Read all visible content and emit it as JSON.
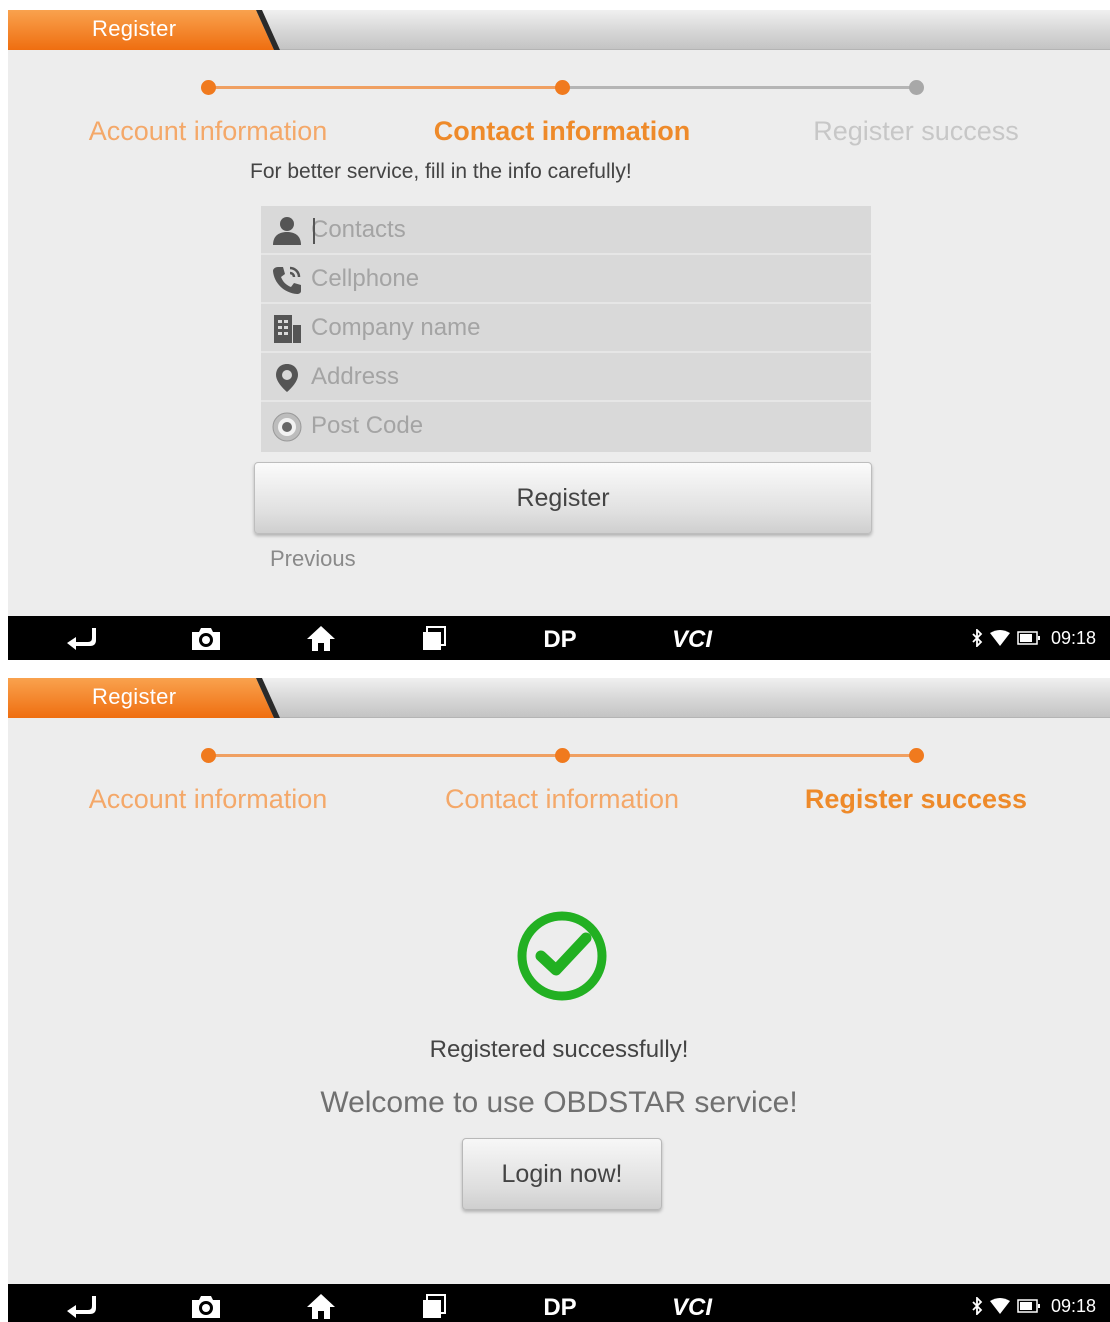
{
  "colors": {
    "accent": "#f07a1e",
    "step_active": "#ee8a2a",
    "step_inactive": "#b5b5b5",
    "success_green": "#22b022",
    "nav_bar": "#000000"
  },
  "screens": [
    {
      "title": "Register",
      "steps": [
        {
          "label": "Account information"
        },
        {
          "label": "Contact information"
        },
        {
          "label": "Register success"
        }
      ],
      "current_step": 2,
      "hint": "For better service, fill in the info carefully!",
      "fields": [
        {
          "icon": "person-icon",
          "placeholder": "Contacts",
          "value": ""
        },
        {
          "icon": "phone-icon",
          "placeholder": "Cellphone",
          "value": ""
        },
        {
          "icon": "building-icon",
          "placeholder": "Company name",
          "value": ""
        },
        {
          "icon": "location-pin-icon",
          "placeholder": "Address",
          "value": ""
        },
        {
          "icon": "postcode-icon",
          "placeholder": "Post Code",
          "value": ""
        }
      ],
      "register_label": "Register",
      "previous_label": "Previous"
    },
    {
      "title": "Register",
      "steps": [
        {
          "label": "Account information"
        },
        {
          "label": "Contact information"
        },
        {
          "label": "Register success"
        }
      ],
      "current_step": 3,
      "success_icon": "check-circle-icon",
      "success_message": "Registered successfully!",
      "welcome_message": "Welcome to use OBDSTAR service!",
      "login_label": "Login now!"
    }
  ],
  "nav_bar": {
    "buttons": [
      "back-icon",
      "camera-icon",
      "home-icon",
      "recent-apps-icon",
      "dp-icon",
      "vci-icon"
    ],
    "dp_label": "DP",
    "vci_label": "VCI",
    "status_icons": [
      "bluetooth-icon",
      "wifi-icon",
      "battery-icon"
    ],
    "time": "09:18"
  }
}
